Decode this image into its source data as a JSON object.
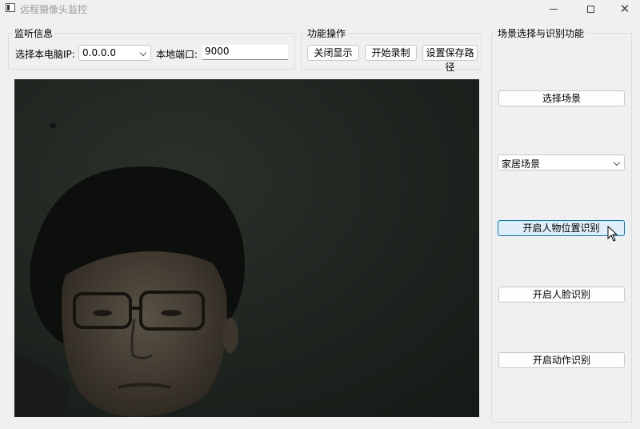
{
  "window": {
    "title": "远程摄像头监控"
  },
  "listen": {
    "title": "监听信息",
    "ip_label": "选择本电脑IP:",
    "ip_value": "0.0.0.0",
    "port_label": "本地端口:",
    "port_value": "9000"
  },
  "ops": {
    "title": "功能操作",
    "close_display": "关闭显示",
    "start_record": "开始录制",
    "set_save_path": "设置保存路径"
  },
  "scene": {
    "title": "场景选择与识别功能",
    "select_scene": "选择场景",
    "scene_value": "家居场景",
    "person_position": "开启人物位置识别",
    "face": "开启人脸识别",
    "action": "开启动作识别"
  },
  "icons": {
    "app": "app-icon",
    "minimize": "minimize-icon",
    "maximize": "maximize-icon",
    "close": "close-icon",
    "dropdown": "chevron-down-icon",
    "cursor": "mouse-pointer-icon"
  },
  "colors": {
    "window_bg": "#f0f0f0",
    "hover_button_bg": "#e0eef9",
    "hover_button_border": "#0078d4",
    "video_bg": "#1d221e"
  }
}
